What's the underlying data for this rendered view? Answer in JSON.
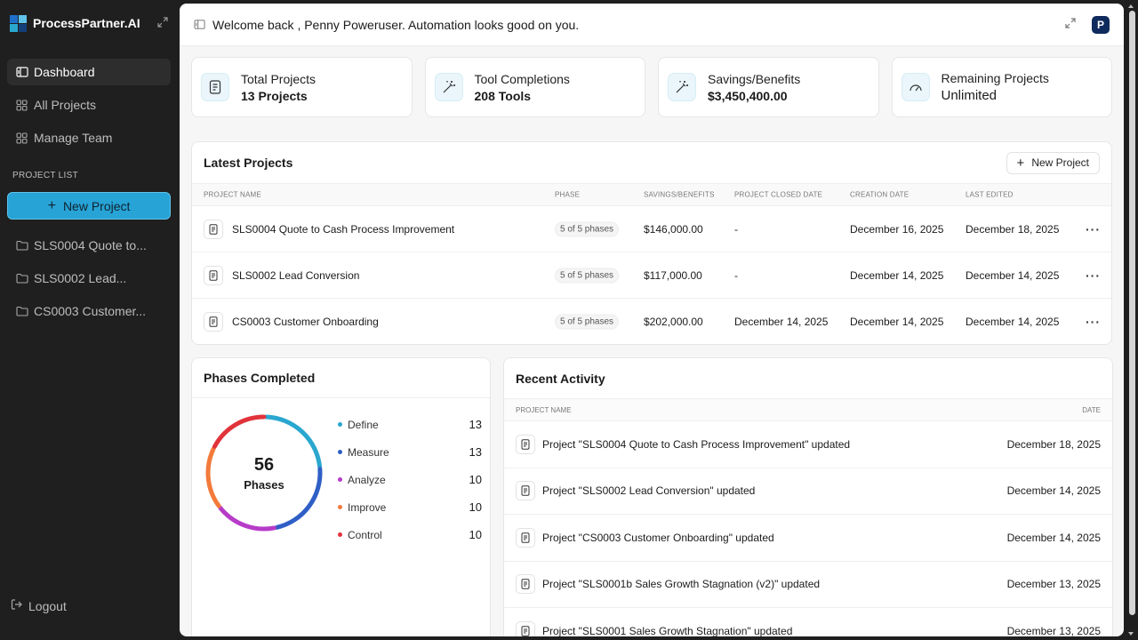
{
  "brand": {
    "name": "ProcessPartner.AI"
  },
  "nav": [
    {
      "label": "Dashboard",
      "icon": "dashboard-icon",
      "active": true
    },
    {
      "label": "All Projects",
      "icon": "grid-icon"
    },
    {
      "label": "Manage Team",
      "icon": "grid-icon"
    }
  ],
  "sidebar": {
    "section_title": "PROJECT LIST",
    "new_project_label": "New Project",
    "projects": [
      "SLS0004 Quote to...",
      "SLS0002 Lead...",
      "CS0003 Customer..."
    ],
    "logout_label": "Logout"
  },
  "topbar": {
    "welcome": "Welcome back , Penny Poweruser. Automation looks good on you.",
    "avatar": "P"
  },
  "cards": [
    {
      "label": "Total Projects",
      "value": "13 Projects",
      "icon": "document-icon"
    },
    {
      "label": "Tool Completions",
      "value": "208 Tools",
      "icon": "magic-wand-icon"
    },
    {
      "label": "Savings/Benefits",
      "value": "$3,450,400.00",
      "icon": "magic-wand-icon"
    },
    {
      "label": "Remaining Projects",
      "value": "Unlimited",
      "icon": "gauge-icon"
    }
  ],
  "latest": {
    "title": "Latest Projects",
    "new_button": "New Project",
    "columns": [
      "PROJECT NAME",
      "PHASE",
      "SAVINGS/BENEFITS",
      "PROJECT CLOSED DATE",
      "CREATION DATE",
      "LAST EDITED"
    ],
    "rows": [
      {
        "name": "SLS0004 Quote to Cash Process Improvement",
        "phase": "5 of 5 phases",
        "savings": "$146,000.00",
        "closed": "-",
        "created": "December 16, 2025",
        "edited": "December 18, 2025"
      },
      {
        "name": "SLS0002 Lead Conversion",
        "phase": "5 of 5 phases",
        "savings": "$117,000.00",
        "closed": "-",
        "created": "December 14, 2025",
        "edited": "December 14, 2025"
      },
      {
        "name": "CS0003 Customer Onboarding",
        "phase": "5 of 5 phases",
        "savings": "$202,000.00",
        "closed": "December 14, 2025",
        "created": "December 14, 2025",
        "edited": "December 14, 2025"
      }
    ]
  },
  "phases": {
    "title": "Phases Completed",
    "total": "56",
    "total_label": "Phases",
    "items": [
      {
        "label": "Define",
        "value": "13",
        "color": "#2aa7cf"
      },
      {
        "label": "Measure",
        "value": "13",
        "color": "#2f5fc6"
      },
      {
        "label": "Analyze",
        "value": "10",
        "color": "#b63cc8"
      },
      {
        "label": "Improve",
        "value": "10",
        "color": "#f37a3b"
      },
      {
        "label": "Control",
        "value": "10",
        "color": "#e1333b"
      }
    ]
  },
  "activity": {
    "title": "Recent Activity",
    "col_name": "PROJECT NAME",
    "col_date": "DATE",
    "rows": [
      {
        "text": "Project \"SLS0004 Quote to Cash Process Improvement\" updated",
        "date": "December 18, 2025"
      },
      {
        "text": "Project \"SLS0002 Lead Conversion\" updated",
        "date": "December 14, 2025"
      },
      {
        "text": "Project \"CS0003 Customer Onboarding\" updated",
        "date": "December 14, 2025"
      },
      {
        "text": "Project \"SLS0001b Sales Growth Stagnation (v2)\" updated",
        "date": "December 13, 2025"
      },
      {
        "text": "Project \"SLS0001 Sales Growth Stagnation\" updated",
        "date": "December 13, 2025"
      }
    ]
  }
}
